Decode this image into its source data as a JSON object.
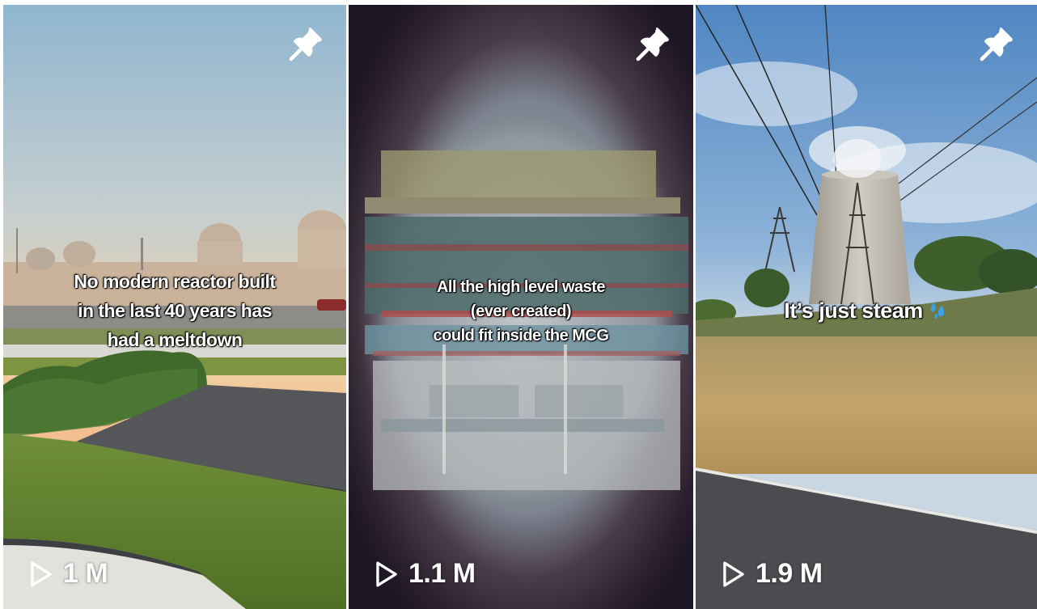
{
  "videos": [
    {
      "caption_lines": [
        "No modern reactor built",
        "in the last 40 years has",
        "had a meltdown"
      ],
      "views": "1 M",
      "pinned_icon": "pushpin-icon",
      "play_icon": "play-outline-icon"
    },
    {
      "caption_lines": [
        "All the high level waste",
        "(ever created)",
        "could fit inside the MCG"
      ],
      "views": "1.1 M",
      "pinned_icon": "pushpin-icon",
      "play_icon": "play-outline-icon"
    },
    {
      "caption_lines": [
        "It’s just steam"
      ],
      "caption_emoji": "sweat-droplets-icon",
      "views": "1.9 M",
      "pinned_icon": "pushpin-icon",
      "play_icon": "play-outline-icon"
    }
  ],
  "colors": {
    "background": "#ffffff",
    "text": "#ffffff",
    "emoji_blue": "#3aa0e8"
  }
}
